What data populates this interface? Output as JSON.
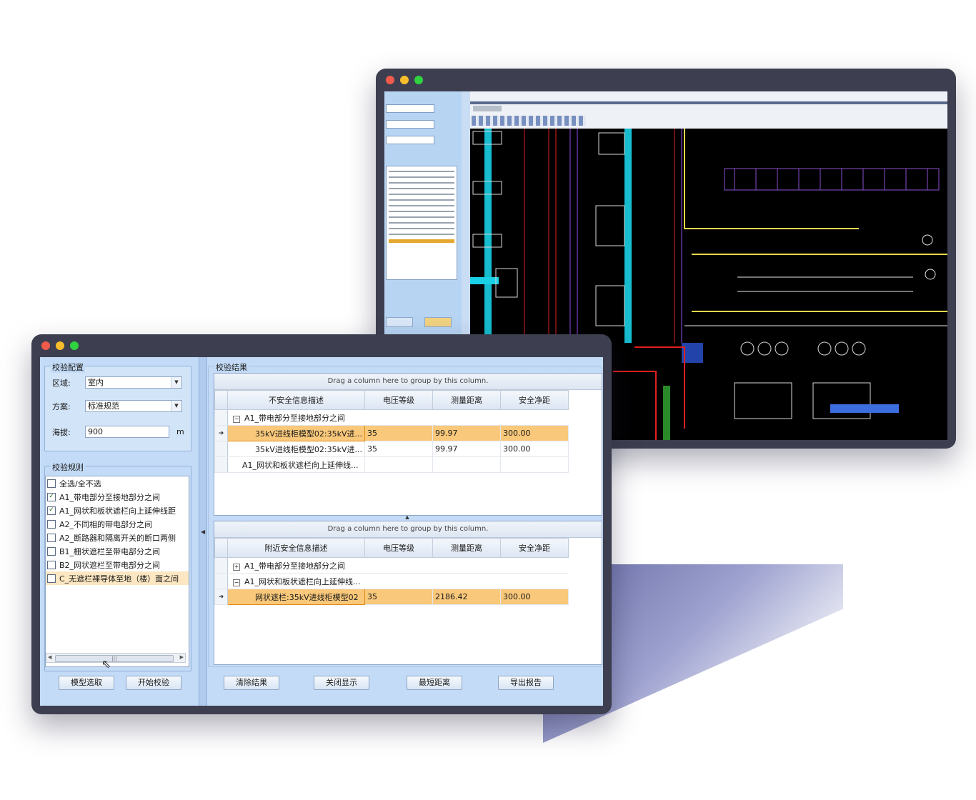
{
  "colors": {
    "window_frame": "#3d3f50",
    "app_bg": "#c3dbf6",
    "selected_row": "#f9c87a"
  },
  "check_window": {
    "config": {
      "title": "校验配置",
      "region_label": "区域:",
      "region_value": "室内",
      "scheme_label": "方案:",
      "scheme_value": "标准规范",
      "altitude_label": "海拔:",
      "altitude_value": "900",
      "altitude_unit": "m"
    },
    "rules": {
      "title": "校验规则",
      "items": [
        {
          "label": "全选/全不选",
          "checked": false
        },
        {
          "label": "A1_带电部分至接地部分之间",
          "checked": true
        },
        {
          "label": "A1_网状和板状遮栏向上延伸线距",
          "checked": true
        },
        {
          "label": "A2_不同相的带电部分之间",
          "checked": false
        },
        {
          "label": "A2_断路器和隔离开关的断口两侧",
          "checked": false
        },
        {
          "label": "B1_栅状遮栏至带电部分之间",
          "checked": false
        },
        {
          "label": "B2_网状遮栏至带电部分之间",
          "checked": false
        },
        {
          "label": "C_无遮栏裸导体至地（楼）面之间",
          "checked": false
        }
      ]
    },
    "left_buttons": {
      "select_model": "模型选取",
      "start_check": "开始校验"
    },
    "results": {
      "title": "校验结果",
      "drag_hint": "Drag a column here to group by this column.",
      "unsafe_grid": {
        "columns": [
          "不安全信息描述",
          "电压等级",
          "测量距离",
          "安全净距"
        ],
        "group_row": "A1_带电部分至接地部分之间",
        "rows": [
          [
            "35kV进线柜模型02:35kV进...",
            "35",
            "99.97",
            "300.00"
          ],
          [
            "35kV进线柜模型02:35kV进...",
            "35",
            "99.97",
            "300.00"
          ]
        ],
        "group_row_2": "A1_网状和板状遮栏向上延伸线..."
      },
      "nearby_grid": {
        "columns": [
          "附近安全信息描述",
          "电压等级",
          "测量距离",
          "安全净距"
        ],
        "group_row": "A1_带电部分至接地部分之间",
        "group_row_2": "A1_网状和板状遮栏向上延伸线...",
        "rows": [
          [
            "网状遮栏:35kV进线柜模型02",
            "35",
            "2186.42",
            "300.00"
          ]
        ]
      },
      "buttons": {
        "clear": "清除结果",
        "close_display": "关闭显示",
        "shortest": "最短距离",
        "export": "导出报告"
      }
    }
  }
}
